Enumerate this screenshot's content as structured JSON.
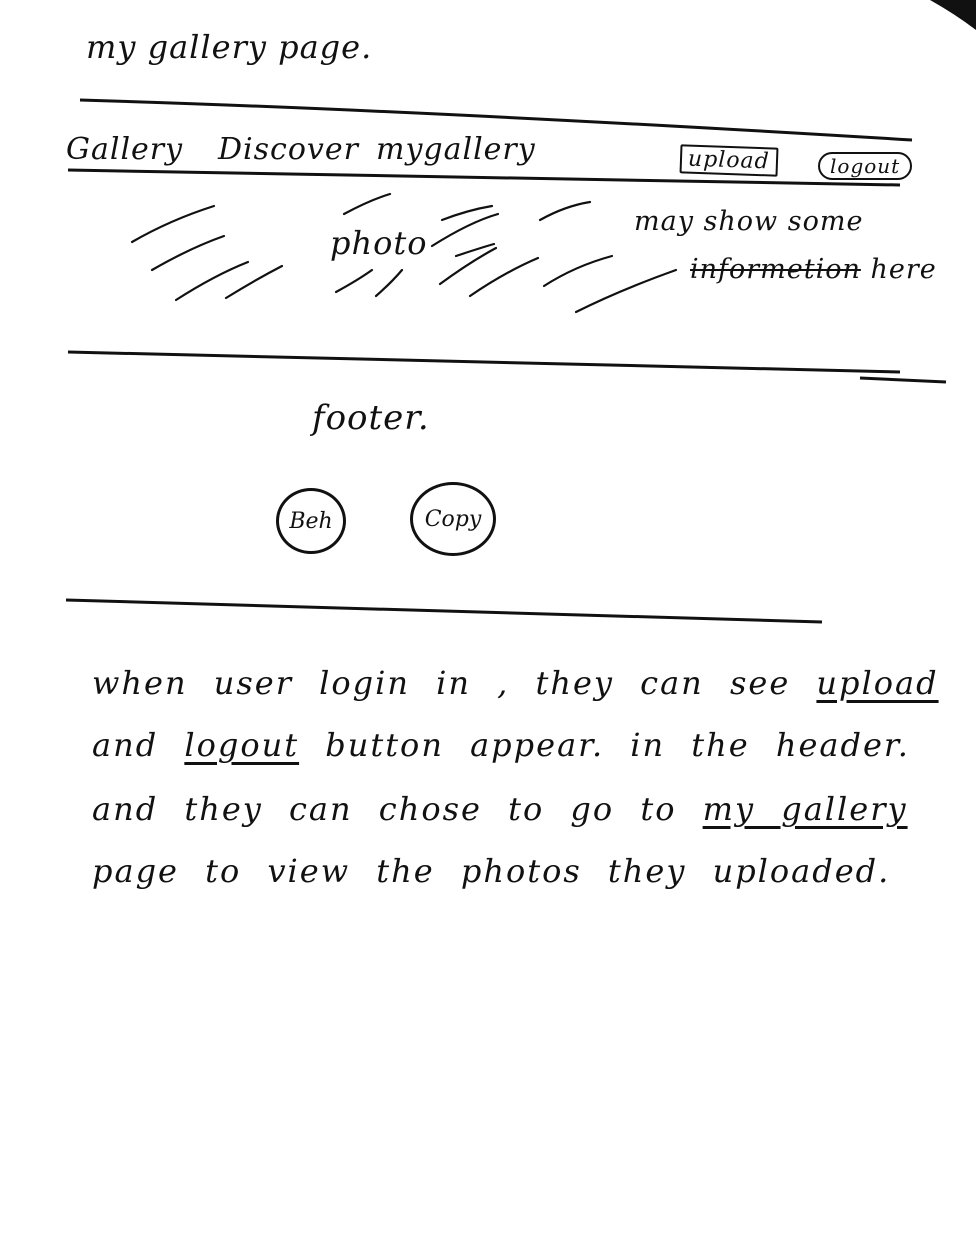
{
  "title": "my gallery page.",
  "header": {
    "nav": [
      "Gallery",
      "Discover",
      "mygallery"
    ],
    "upload": "upload",
    "logout": "logout"
  },
  "content": {
    "photo": "photo",
    "info_line1": "may show some",
    "info_line2_struck": "informetion",
    "info_line2_rest": " here"
  },
  "footer": {
    "label": "footer.",
    "social": [
      "Beh",
      "Copy"
    ]
  },
  "note": {
    "l1_a": "when user login in , they can see ",
    "l1_u": "upload",
    "l2_a": "and ",
    "l2_u": "logout",
    "l2_b": " button appear. in the header.",
    "l3_a": "and they can chose to go to ",
    "l3_u": "my gallery",
    "l4": "page to view the photos they uploaded."
  }
}
